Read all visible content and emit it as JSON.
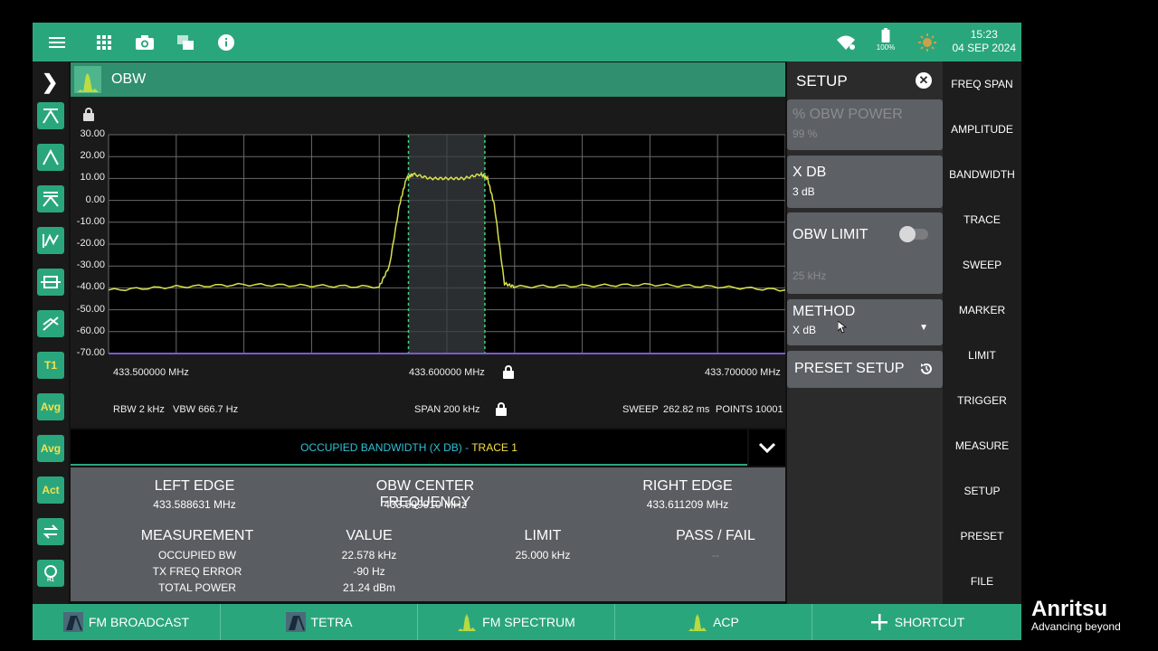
{
  "topbar": {
    "icons": [
      "menu-icon",
      "apps-grid-icon",
      "camera-icon",
      "windows-icon",
      "info-icon"
    ],
    "battery_label": "100%",
    "time": "15:23",
    "date": "04 SEP 2024"
  },
  "header": {
    "title": "OBW"
  },
  "left_tools": [
    {
      "name": "marker-tool-1",
      "label": ""
    },
    {
      "name": "marker-tool-2",
      "label": ""
    },
    {
      "name": "marker-tool-3",
      "label": ""
    },
    {
      "name": "marker-tool-4",
      "label": ""
    },
    {
      "name": "marker-tool-5",
      "label": ""
    },
    {
      "name": "marker-tool-6",
      "label": ""
    },
    {
      "name": "trace-t1",
      "label": "T1"
    },
    {
      "name": "trace-avg-1",
      "label": "Avg"
    },
    {
      "name": "trace-avg-2",
      "label": "Avg"
    },
    {
      "name": "trace-act",
      "label": "Act"
    },
    {
      "name": "swap-tool",
      "label": ""
    },
    {
      "name": "hold-tool",
      "label": ""
    }
  ],
  "plot": {
    "y_ticks": [
      "30.00",
      "20.00",
      "10.00",
      "0.00",
      "-10.00",
      "-20.00",
      "-30.00",
      "-40.00",
      "-50.00",
      "-60.00",
      "-70.00"
    ],
    "x_left": "433.500000 MHz",
    "x_center": "433.600000 MHz",
    "x_right": "433.700000 MHz",
    "rbw": "RBW 2 kHz",
    "vbw": "VBW 666.7 Hz",
    "span": "SPAN 200 kHz",
    "sweep_label": "SWEEP",
    "sweep_value": "262.82 ms",
    "points": "POINTS 10001"
  },
  "chart_data": {
    "type": "line",
    "xlim": [
      433.5,
      433.7
    ],
    "ylim": [
      -70,
      30
    ],
    "x_unit": "MHz",
    "y_unit": "dBm",
    "series": [
      {
        "x": [
          433.5,
          433.52,
          433.54,
          433.56,
          433.58,
          433.583,
          433.586,
          433.588,
          433.59,
          433.595,
          433.6,
          433.605,
          433.61,
          433.612,
          433.614,
          433.617,
          433.62,
          433.64,
          433.66,
          433.68,
          433.7
        ],
        "y": [
          -41,
          -39.5,
          -38.5,
          -39,
          -39.5,
          -30,
          -2,
          10,
          12,
          10,
          10,
          10,
          12,
          10,
          -2,
          -38,
          -39.5,
          -39,
          -38.5,
          -39.5,
          -41
        ]
      }
    ],
    "occupied_band": [
      433.588631,
      433.611209
    ]
  },
  "obw_bar": {
    "label": "OCCUPIED BANDWIDTH (X DB) - ",
    "trace": "TRACE 1"
  },
  "results": {
    "left_edge_label": "LEFT EDGE",
    "left_edge_value": "433.588631 MHz",
    "center_label": "OBW CENTER FREQUENCY",
    "center_value": "433.599910 MHz",
    "right_edge_label": "RIGHT EDGE",
    "right_edge_value": "433.611209 MHz",
    "measurement_label": "MEASUREMENT",
    "value_label": "VALUE",
    "limit_label": "LIMIT",
    "passfail_label": "PASS / FAIL",
    "rows": [
      {
        "name": "OCCUPIED BW",
        "value": "22.578 kHz",
        "limit": "25.000 kHz",
        "passfail": "--"
      },
      {
        "name": "TX FREQ ERROR",
        "value": "-90 Hz",
        "limit": "",
        "passfail": ""
      },
      {
        "name": "TOTAL POWER",
        "value": "21.24 dBm",
        "limit": "",
        "passfail": ""
      }
    ]
  },
  "setup": {
    "title": "SETUP",
    "obw_power_label": "% OBW POWER",
    "obw_power_value": "99 %",
    "xdb_label": "X DB",
    "xdb_value": "3 dB",
    "obw_limit_label": "OBW LIMIT",
    "obw_limit_value": "25 kHz",
    "method_label": "METHOD",
    "method_value": "X dB",
    "preset_label": "PRESET SETUP"
  },
  "right_menu": [
    "FREQ SPAN",
    "AMPLITUDE",
    "BANDWIDTH",
    "TRACE",
    "SWEEP",
    "MARKER",
    "LIMIT",
    "TRIGGER",
    "MEASURE",
    "SETUP",
    "PRESET",
    "FILE"
  ],
  "bottom_bar": [
    {
      "label": "FM BROADCAST",
      "icon": "fm-broadcast-icon"
    },
    {
      "label": "TETRA",
      "icon": "tetra-icon"
    },
    {
      "label": "FM SPECTRUM",
      "icon": "spectrum-icon"
    },
    {
      "label": "ACP",
      "icon": "acp-spectrum-icon"
    },
    {
      "label": "SHORTCUT",
      "icon": "plus-icon"
    }
  ],
  "brand": {
    "name": "Anritsu",
    "tagline": "Advancing beyond"
  },
  "colors": {
    "accent": "#2aa67d",
    "trace": "#d8e04a",
    "band": "#3fd47a",
    "info": "#2ec1d4"
  }
}
